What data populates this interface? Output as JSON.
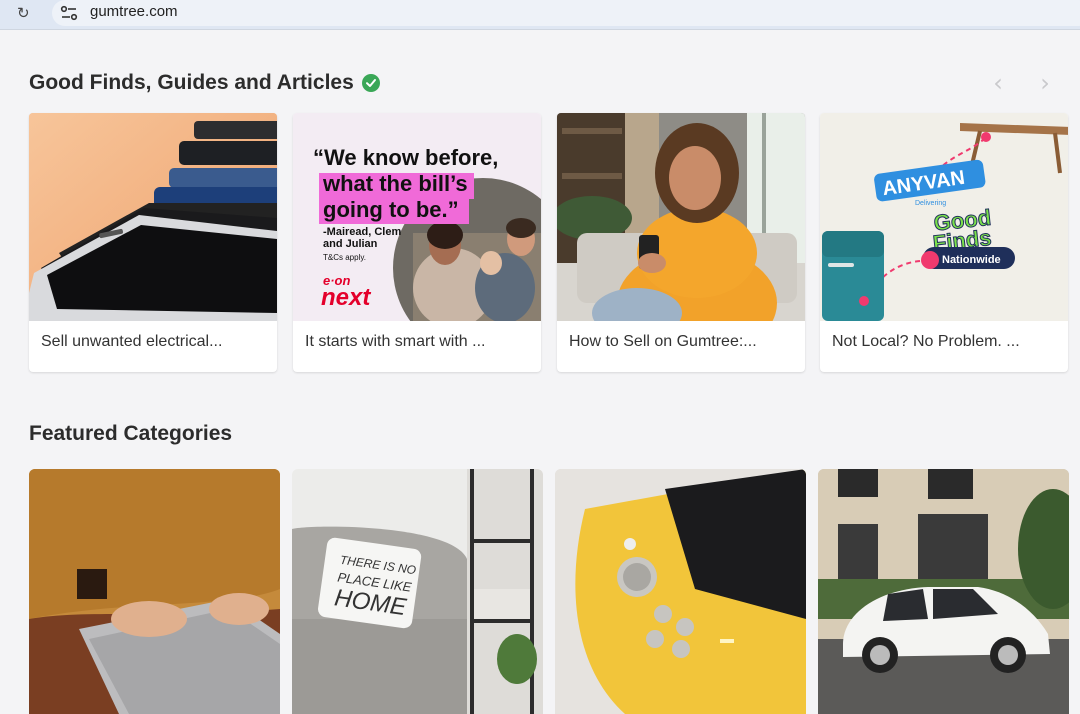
{
  "browser": {
    "url": "gumtree.com",
    "reload_icon": "reload-icon",
    "site_info_icon": "site-settings-icon"
  },
  "articles": {
    "title": "Good Finds, Guides and Articles",
    "verified_icon": "verified-check-icon",
    "prev_icon": "chevron-left-icon",
    "next_icon": "chevron-right-icon",
    "cards": [
      {
        "caption": "Sell unwanted electrical...",
        "image": "stacked-phones-photo"
      },
      {
        "caption": "It starts with smart with ...",
        "image": "eon-next-advert",
        "ad_quote": "“We know before, what the bill’s going to be.”",
        "ad_quote_lines": [
          "“We know before,",
          "what the bill’s",
          "going to be.”"
        ],
        "ad_attribution_lines": [
          "-Mairead, Clem",
          "and Julian"
        ],
        "ad_tcs": "T&Cs apply.",
        "ad_brand_top": "e·on",
        "ad_brand_bottom": "next"
      },
      {
        "caption": "How to Sell on Gumtree:...",
        "image": "woman-with-phone-photo"
      },
      {
        "caption": "Not Local? No Problem. ...",
        "image": "anyvan-good-finds-graphic",
        "brand": "ANYVAN",
        "brand_sub": "Delivering",
        "good_finds_lines": [
          "Good",
          "Finds"
        ],
        "badge": "Nationwide"
      }
    ]
  },
  "categories": {
    "title": "Featured Categories",
    "cards": [
      {
        "image": "laptop-typing-photo"
      },
      {
        "image": "armchair-home-photo",
        "pillow_lines": [
          "THERE IS NO",
          "PLACE LIKE",
          "HOME"
        ]
      },
      {
        "image": "yellow-game-console-photo"
      },
      {
        "image": "white-car-photo"
      }
    ]
  },
  "colors": {
    "verified": "#3aa757",
    "eon_red": "#e4002b",
    "eon_pink": "#f06ad8",
    "anyvan_blue": "#2f8fe0",
    "good_finds_green": "#7be04a",
    "nationwide_navy": "#1f2f5a",
    "pin_pink": "#f03a6e"
  }
}
